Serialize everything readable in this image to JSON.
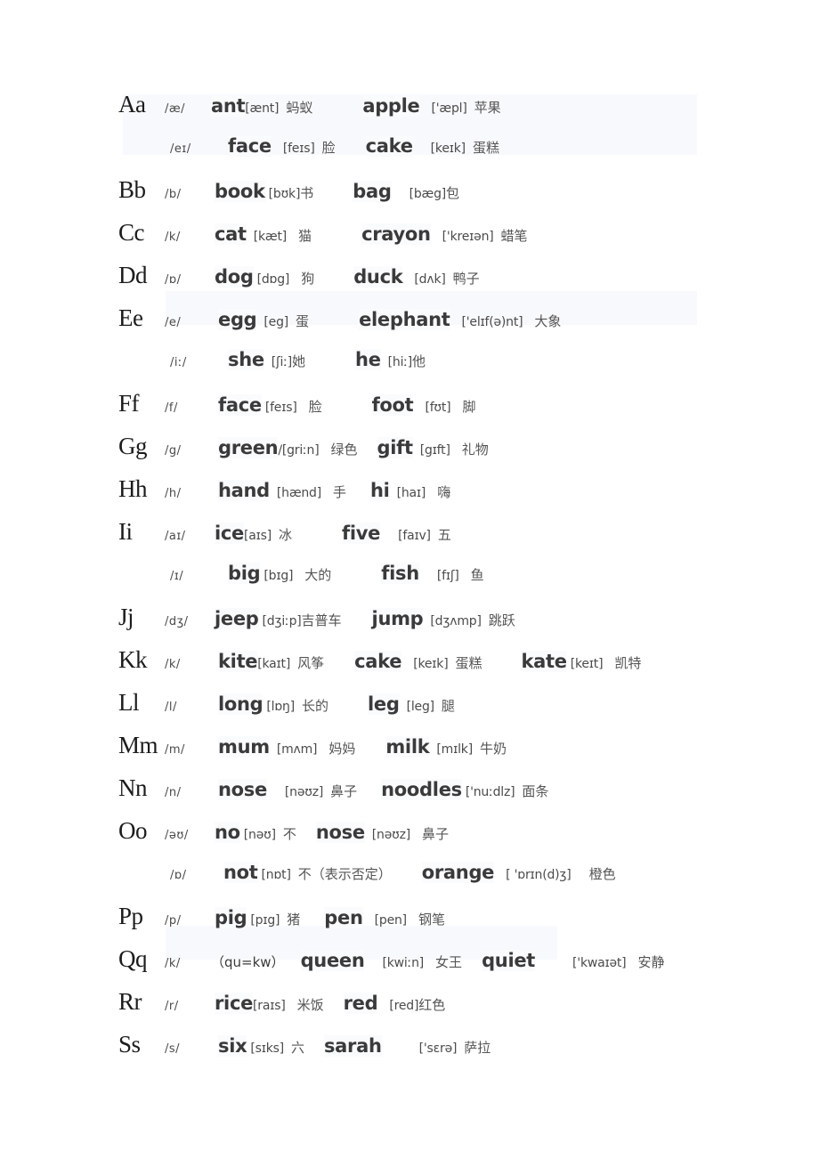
{
  "document": {
    "kind": "alphabet-phonics-worksheet",
    "text_color": "#3a3a3a",
    "letter_color": "#1c1c1c",
    "highlight_color": "#f8f9fc",
    "background": "#ffffff"
  },
  "rows": [
    {
      "letter": "Aa",
      "key": "/æ/",
      "note": "",
      "entries": [
        {
          "word": "ant",
          "gap_word": "g0",
          "ipa": "[ænt]",
          "gap_ipa": "g0",
          "cn": "蚂蚁",
          "gap_cn": "g2"
        },
        {
          "word": "apple",
          "gap_word": "g6",
          "ipa": "['æpl]",
          "gap_ipa": "g3",
          "cn": "苹果",
          "gap_cn": "g2"
        }
      ]
    },
    {
      "letter": "",
      "key": "/eɪ/",
      "note": "",
      "entries": [
        {
          "word": "face",
          "gap_word": "g3",
          "ipa": "[feɪs]",
          "gap_ipa": "g3",
          "cn": "脸",
          "gap_cn": "g2"
        },
        {
          "word": "cake",
          "gap_word": "g4",
          "ipa": "[keɪk]",
          "gap_ipa": "g4",
          "cn": "蛋糕",
          "gap_cn": "g2"
        }
      ]
    },
    {
      "letter": "Bb",
      "key": "/b/",
      "note": "",
      "entries": [
        {
          "word": "book",
          "gap_word": "g1",
          "ipa": "[bʊk]",
          "gap_ipa": "g1",
          "cn": "书",
          "gap_cn": "g0"
        },
        {
          "word": "bag",
          "gap_word": "g5",
          "ipa": "[bæg]",
          "gap_ipa": "g4",
          "cn": "包",
          "gap_cn": "g0"
        }
      ]
    },
    {
      "letter": "Cc",
      "key": "/k/",
      "note": "",
      "entries": [
        {
          "word": "cat",
          "gap_word": "g1",
          "ipa": "[kæt]",
          "gap_ipa": "g2",
          "cn": "猫",
          "gap_cn": "g3"
        },
        {
          "word": "crayon",
          "gap_word": "g6",
          "ipa": "['kreɪən]",
          "gap_ipa": "g3",
          "cn": "蜡笔",
          "gap_cn": "g2"
        }
      ]
    },
    {
      "letter": "Dd",
      "key": "/ɒ/",
      "note": "",
      "entries": [
        {
          "word": "dog",
          "gap_word": "g1",
          "ipa": "[dɒg]",
          "gap_ipa": "g1",
          "cn": "狗",
          "gap_cn": "g3"
        },
        {
          "word": "duck",
          "gap_word": "g5",
          "ipa": "[dʌk]",
          "gap_ipa": "g3",
          "cn": "鸭子",
          "gap_cn": "g2"
        }
      ]
    },
    {
      "letter": "Ee",
      "key": "/e/",
      "note": "",
      "entries": [
        {
          "word": "egg",
          "gap_word": "g2",
          "ipa": "[eg]",
          "gap_ipa": "g2",
          "cn": "蛋",
          "gap_cn": "g2"
        },
        {
          "word": "elephant",
          "gap_word": "g6",
          "ipa": "['elɪf(ə)nt]",
          "gap_ipa": "g3",
          "cn": "大象",
          "gap_cn": "g3"
        }
      ]
    },
    {
      "letter": "",
      "key": "/iː/",
      "note": "",
      "entries": [
        {
          "word": "she",
          "gap_word": "g3",
          "ipa": "[ʃiː]",
          "gap_ipa": "g2",
          "cn": "她",
          "gap_cn": "g0"
        },
        {
          "word": "he",
          "gap_word": "g6",
          "ipa": "[hiː]",
          "gap_ipa": "g2",
          "cn": "他",
          "gap_cn": "g0"
        }
      ]
    },
    {
      "letter": "Ff",
      "key": "/f/",
      "note": "",
      "entries": [
        {
          "word": "face",
          "gap_word": "g2",
          "ipa": "[feɪs]",
          "gap_ipa": "g1",
          "cn": "脸",
          "gap_cn": "g3"
        },
        {
          "word": "foot",
          "gap_word": "g6",
          "ipa": "[fʊt]",
          "gap_ipa": "g3",
          "cn": "脚",
          "gap_cn": "g3"
        }
      ]
    },
    {
      "letter": "Gg",
      "key": "/g/",
      "note": "",
      "entries": [
        {
          "word": "green",
          "gap_word": "g2",
          "ipa": "/[griːn]",
          "gap_ipa": "g0",
          "cn": "绿色",
          "gap_cn": "g3"
        },
        {
          "word": "gift",
          "gap_word": "g2",
          "ipa": "[gɪft]",
          "gap_ipa": "g2",
          "cn": "礼物",
          "gap_cn": "g3"
        }
      ]
    },
    {
      "letter": "Hh",
      "key": "/h/",
      "note": "",
      "entries": [
        {
          "word": "hand",
          "gap_word": "g2",
          "ipa": "[hænd]",
          "gap_ipa": "g2",
          "cn": "手",
          "gap_cn": "g3"
        },
        {
          "word": "hi",
          "gap_word": "g3",
          "ipa": "[haɪ]",
          "gap_ipa": "g2",
          "cn": "嗨",
          "gap_cn": "g3"
        }
      ]
    },
    {
      "letter": "Ii",
      "key": "/aɪ/",
      "note": "",
      "entries": [
        {
          "word": "ice",
          "gap_word": "g1",
          "ipa": "[aɪs]",
          "gap_ipa": "g0",
          "cn": "冰",
          "gap_cn": "g2"
        },
        {
          "word": "five",
          "gap_word": "g6",
          "ipa": "[faɪv]",
          "gap_ipa": "g4",
          "cn": "五",
          "gap_cn": "g2"
        }
      ]
    },
    {
      "letter": "",
      "key": "/ɪ/",
      "note": "",
      "entries": [
        {
          "word": "big",
          "gap_word": "g3",
          "ipa": "[bɪg]",
          "gap_ipa": "g1",
          "cn": "大的",
          "gap_cn": "g3"
        },
        {
          "word": "fish",
          "gap_word": "g6",
          "ipa": "[fɪʃ]",
          "gap_ipa": "g4",
          "cn": "鱼",
          "gap_cn": "g3"
        }
      ]
    },
    {
      "letter": "Jj",
      "key": "/dʒ/",
      "note": "",
      "entries": [
        {
          "word": "jeep",
          "gap_word": "g1",
          "ipa": "[dʒiːp]",
          "gap_ipa": "g1",
          "cn": "吉普车",
          "gap_cn": "g0"
        },
        {
          "word": "jump",
          "gap_word": "g4",
          "ipa": "[dʒʌmp]",
          "gap_ipa": "g2",
          "cn": "跳跃",
          "gap_cn": "g2"
        }
      ]
    },
    {
      "letter": "Kk",
      "key": "/k/",
      "note": "",
      "entries": [
        {
          "word": "kite",
          "gap_word": "g2",
          "ipa": "[kaɪt]",
          "gap_ipa": "g0",
          "cn": "风筝",
          "gap_cn": "g2"
        },
        {
          "word": "cake",
          "gap_word": "g4",
          "ipa": "[keɪk]",
          "gap_ipa": "g3",
          "cn": "蛋糕",
          "gap_cn": "g2"
        },
        {
          "word": "kate",
          "gap_word": "g5",
          "ipa": "[keɪt]",
          "gap_ipa": "g1",
          "cn": "凯特",
          "gap_cn": "g3"
        }
      ]
    },
    {
      "letter": "Ll",
      "key": "/l/",
      "note": "",
      "entries": [
        {
          "word": "long",
          "gap_word": "g2",
          "ipa": "[lɒŋ]",
          "gap_ipa": "g1",
          "cn": "长的",
          "gap_cn": "g2"
        },
        {
          "word": "leg",
          "gap_word": "g5",
          "ipa": "[leg]",
          "gap_ipa": "g2",
          "cn": "腿",
          "gap_cn": "g2"
        }
      ]
    },
    {
      "letter": "Mm",
      "key": "/m/",
      "note": "",
      "entries": [
        {
          "word": "mum",
          "gap_word": "g2",
          "ipa": "[mʌm]",
          "gap_ipa": "g2",
          "cn": "妈妈",
          "gap_cn": "g3"
        },
        {
          "word": "milk",
          "gap_word": "g4",
          "ipa": "[mɪlk]",
          "gap_ipa": "g2",
          "cn": "牛奶",
          "gap_cn": "g2"
        }
      ]
    },
    {
      "letter": "Nn",
      "key": "/n/",
      "note": "",
      "entries": [
        {
          "word": "nose",
          "gap_word": "g2",
          "ipa": "[nəʊz]",
          "gap_ipa": "g4",
          "cn": "鼻子",
          "gap_cn": "g2"
        },
        {
          "word": "noodles",
          "gap_word": "g3",
          "ipa": "['nuːdlz]",
          "gap_ipa": "g1",
          "cn": "面条",
          "gap_cn": "g2"
        }
      ]
    },
    {
      "letter": "Oo",
      "key": "/əʊ/",
      "note": "",
      "entries": [
        {
          "word": "no",
          "gap_word": "g1",
          "ipa": "[nəʊ]",
          "gap_ipa": "g1",
          "cn": "不",
          "gap_cn": "g2"
        },
        {
          "word": "nose",
          "gap_word": "g2",
          "ipa": "[nəʊz]",
          "gap_ipa": "g2",
          "cn": "鼻子",
          "gap_cn": "g3"
        }
      ]
    },
    {
      "letter": "",
      "key": "/ɒ/",
      "note": "",
      "entries": [
        {
          "word": "not",
          "gap_word": "g2",
          "ipa": "[nɒt]",
          "gap_ipa": "g1",
          "cn": "不（表示否定）",
          "gap_cn": "g2"
        },
        {
          "word": "orange",
          "gap_word": "g4",
          "ipa": "[ 'ɒrɪn(d)ʒ]",
          "gap_ipa": "g3",
          "cn": "橙色",
          "gap_cn": "g4"
        }
      ]
    },
    {
      "letter": "Pp",
      "key": "/p/",
      "note": "",
      "entries": [
        {
          "word": "pig",
          "gap_word": "g1",
          "ipa": "[pɪg]",
          "gap_ipa": "g1",
          "cn": "猪",
          "gap_cn": "g2"
        },
        {
          "word": "pen",
          "gap_word": "g3",
          "ipa": "[pen]",
          "gap_ipa": "g3",
          "cn": "钢笔",
          "gap_cn": "g3"
        }
      ]
    },
    {
      "letter": "Qq",
      "key": "/k/",
      "note": "（qu=kw）",
      "entries": [
        {
          "word": "queen",
          "gap_word": "g2",
          "ipa": "[kwiːn]",
          "gap_ipa": "g4",
          "cn": "女王",
          "gap_cn": "g3"
        },
        {
          "word": "quiet",
          "gap_word": "g2",
          "ipa": "['kwaɪət]",
          "gap_ipa": "g6",
          "cn": "安静",
          "gap_cn": "g3"
        }
      ]
    },
    {
      "letter": "Rr",
      "key": "/r/",
      "note": "",
      "entries": [
        {
          "word": "rice",
          "gap_word": "g1",
          "ipa": "[raɪs]",
          "gap_ipa": "g0",
          "cn": "米饭",
          "gap_cn": "g3"
        },
        {
          "word": "red",
          "gap_word": "g2",
          "ipa": "[red]",
          "gap_ipa": "g3",
          "cn": "红色",
          "gap_cn": "g0"
        }
      ]
    },
    {
      "letter": "Ss",
      "key": "/s/",
      "note": "",
      "entries": [
        {
          "word": "six",
          "gap_word": "g2",
          "ipa": "[sɪks]",
          "gap_ipa": "g1",
          "cn": "六",
          "gap_cn": "g2"
        },
        {
          "word": "sarah",
          "gap_word": "g2",
          "ipa": "['sɛrə]",
          "gap_ipa": "g6",
          "cn": "萨拉",
          "gap_cn": "g2"
        }
      ]
    }
  ]
}
